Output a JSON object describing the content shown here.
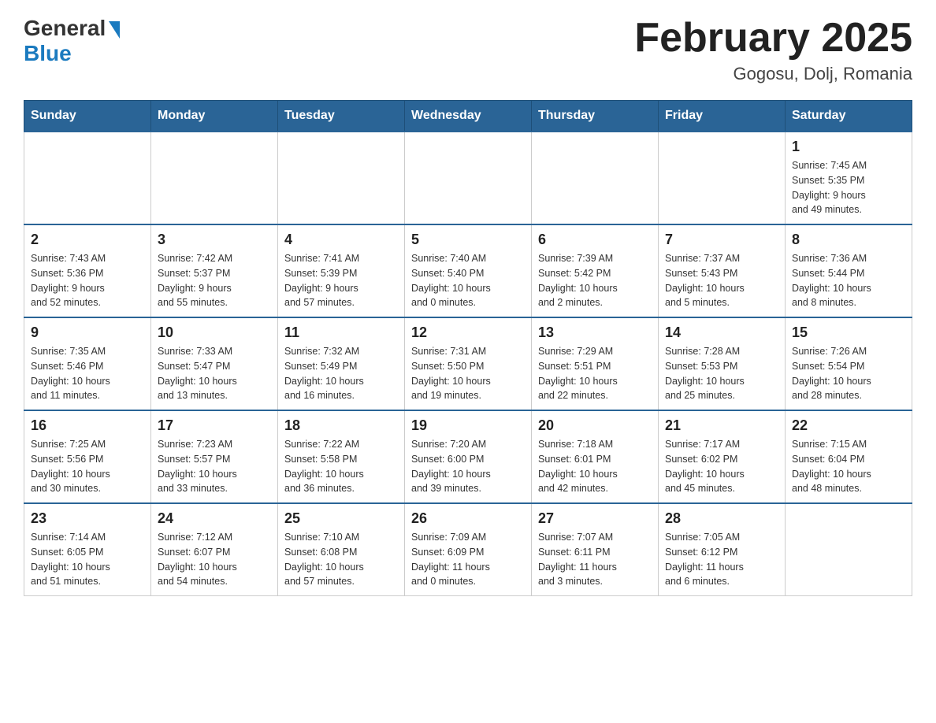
{
  "header": {
    "logo_general": "General",
    "logo_blue": "Blue",
    "month_title": "February 2025",
    "location": "Gogosu, Dolj, Romania"
  },
  "weekdays": [
    "Sunday",
    "Monday",
    "Tuesday",
    "Wednesday",
    "Thursday",
    "Friday",
    "Saturday"
  ],
  "weeks": [
    [
      {
        "day": "",
        "info": ""
      },
      {
        "day": "",
        "info": ""
      },
      {
        "day": "",
        "info": ""
      },
      {
        "day": "",
        "info": ""
      },
      {
        "day": "",
        "info": ""
      },
      {
        "day": "",
        "info": ""
      },
      {
        "day": "1",
        "info": "Sunrise: 7:45 AM\nSunset: 5:35 PM\nDaylight: 9 hours\nand 49 minutes."
      }
    ],
    [
      {
        "day": "2",
        "info": "Sunrise: 7:43 AM\nSunset: 5:36 PM\nDaylight: 9 hours\nand 52 minutes."
      },
      {
        "day": "3",
        "info": "Sunrise: 7:42 AM\nSunset: 5:37 PM\nDaylight: 9 hours\nand 55 minutes."
      },
      {
        "day": "4",
        "info": "Sunrise: 7:41 AM\nSunset: 5:39 PM\nDaylight: 9 hours\nand 57 minutes."
      },
      {
        "day": "5",
        "info": "Sunrise: 7:40 AM\nSunset: 5:40 PM\nDaylight: 10 hours\nand 0 minutes."
      },
      {
        "day": "6",
        "info": "Sunrise: 7:39 AM\nSunset: 5:42 PM\nDaylight: 10 hours\nand 2 minutes."
      },
      {
        "day": "7",
        "info": "Sunrise: 7:37 AM\nSunset: 5:43 PM\nDaylight: 10 hours\nand 5 minutes."
      },
      {
        "day": "8",
        "info": "Sunrise: 7:36 AM\nSunset: 5:44 PM\nDaylight: 10 hours\nand 8 minutes."
      }
    ],
    [
      {
        "day": "9",
        "info": "Sunrise: 7:35 AM\nSunset: 5:46 PM\nDaylight: 10 hours\nand 11 minutes."
      },
      {
        "day": "10",
        "info": "Sunrise: 7:33 AM\nSunset: 5:47 PM\nDaylight: 10 hours\nand 13 minutes."
      },
      {
        "day": "11",
        "info": "Sunrise: 7:32 AM\nSunset: 5:49 PM\nDaylight: 10 hours\nand 16 minutes."
      },
      {
        "day": "12",
        "info": "Sunrise: 7:31 AM\nSunset: 5:50 PM\nDaylight: 10 hours\nand 19 minutes."
      },
      {
        "day": "13",
        "info": "Sunrise: 7:29 AM\nSunset: 5:51 PM\nDaylight: 10 hours\nand 22 minutes."
      },
      {
        "day": "14",
        "info": "Sunrise: 7:28 AM\nSunset: 5:53 PM\nDaylight: 10 hours\nand 25 minutes."
      },
      {
        "day": "15",
        "info": "Sunrise: 7:26 AM\nSunset: 5:54 PM\nDaylight: 10 hours\nand 28 minutes."
      }
    ],
    [
      {
        "day": "16",
        "info": "Sunrise: 7:25 AM\nSunset: 5:56 PM\nDaylight: 10 hours\nand 30 minutes."
      },
      {
        "day": "17",
        "info": "Sunrise: 7:23 AM\nSunset: 5:57 PM\nDaylight: 10 hours\nand 33 minutes."
      },
      {
        "day": "18",
        "info": "Sunrise: 7:22 AM\nSunset: 5:58 PM\nDaylight: 10 hours\nand 36 minutes."
      },
      {
        "day": "19",
        "info": "Sunrise: 7:20 AM\nSunset: 6:00 PM\nDaylight: 10 hours\nand 39 minutes."
      },
      {
        "day": "20",
        "info": "Sunrise: 7:18 AM\nSunset: 6:01 PM\nDaylight: 10 hours\nand 42 minutes."
      },
      {
        "day": "21",
        "info": "Sunrise: 7:17 AM\nSunset: 6:02 PM\nDaylight: 10 hours\nand 45 minutes."
      },
      {
        "day": "22",
        "info": "Sunrise: 7:15 AM\nSunset: 6:04 PM\nDaylight: 10 hours\nand 48 minutes."
      }
    ],
    [
      {
        "day": "23",
        "info": "Sunrise: 7:14 AM\nSunset: 6:05 PM\nDaylight: 10 hours\nand 51 minutes."
      },
      {
        "day": "24",
        "info": "Sunrise: 7:12 AM\nSunset: 6:07 PM\nDaylight: 10 hours\nand 54 minutes."
      },
      {
        "day": "25",
        "info": "Sunrise: 7:10 AM\nSunset: 6:08 PM\nDaylight: 10 hours\nand 57 minutes."
      },
      {
        "day": "26",
        "info": "Sunrise: 7:09 AM\nSunset: 6:09 PM\nDaylight: 11 hours\nand 0 minutes."
      },
      {
        "day": "27",
        "info": "Sunrise: 7:07 AM\nSunset: 6:11 PM\nDaylight: 11 hours\nand 3 minutes."
      },
      {
        "day": "28",
        "info": "Sunrise: 7:05 AM\nSunset: 6:12 PM\nDaylight: 11 hours\nand 6 minutes."
      },
      {
        "day": "",
        "info": ""
      }
    ]
  ]
}
